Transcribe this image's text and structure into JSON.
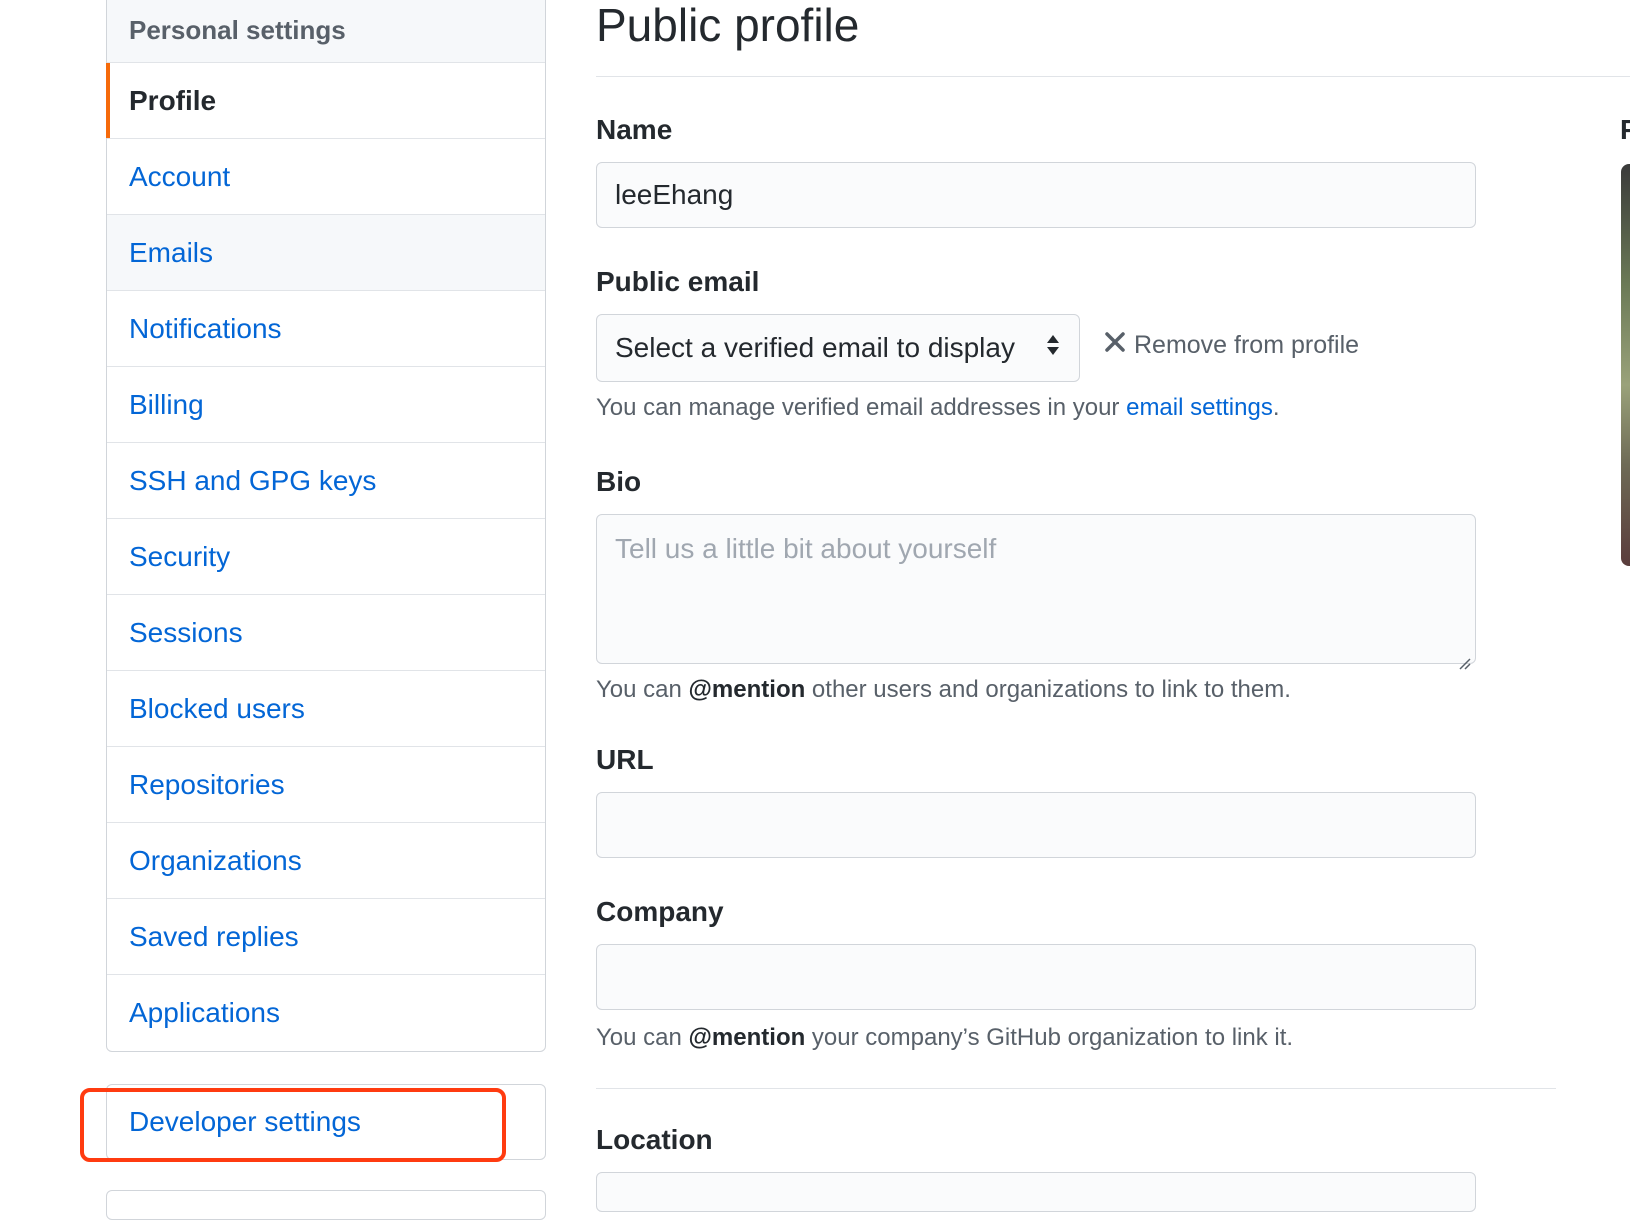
{
  "sidebar": {
    "header": "Personal settings",
    "items": [
      {
        "label": "Profile"
      },
      {
        "label": "Account"
      },
      {
        "label": "Emails"
      },
      {
        "label": "Notifications"
      },
      {
        "label": "Billing"
      },
      {
        "label": "SSH and GPG keys"
      },
      {
        "label": "Security"
      },
      {
        "label": "Sessions"
      },
      {
        "label": "Blocked users"
      },
      {
        "label": "Repositories"
      },
      {
        "label": "Organizations"
      },
      {
        "label": "Saved replies"
      },
      {
        "label": "Applications"
      }
    ],
    "developer_settings": "Developer settings"
  },
  "main": {
    "title": "Public profile",
    "name": {
      "label": "Name",
      "value": "leeEhang"
    },
    "public_email": {
      "label": "Public email",
      "selected": "Select a verified email to display",
      "remove": "Remove from profile",
      "note_prefix": "You can manage verified email addresses in your ",
      "note_link": "email settings",
      "note_suffix": "."
    },
    "bio": {
      "label": "Bio",
      "placeholder": "Tell us a little bit about yourself",
      "note_prefix": "You can ",
      "note_mention": "@mention",
      "note_suffix": " other users and organizations to link to them."
    },
    "url": {
      "label": "URL",
      "value": ""
    },
    "company": {
      "label": "Company",
      "value": "",
      "note_prefix": "You can ",
      "note_mention": "@mention",
      "note_suffix": " your company’s GitHub organization to link it."
    },
    "location": {
      "label": "Location"
    }
  },
  "right_column": {
    "label_fragment": "P"
  },
  "colors": {
    "link": "#0366d6",
    "selected_marker": "#f66a0a",
    "highlight": "#ff3b10"
  },
  "icons": {
    "select_arrows": "select-arrows-icon",
    "remove": "close-icon",
    "resize": "resize-handle-icon"
  }
}
